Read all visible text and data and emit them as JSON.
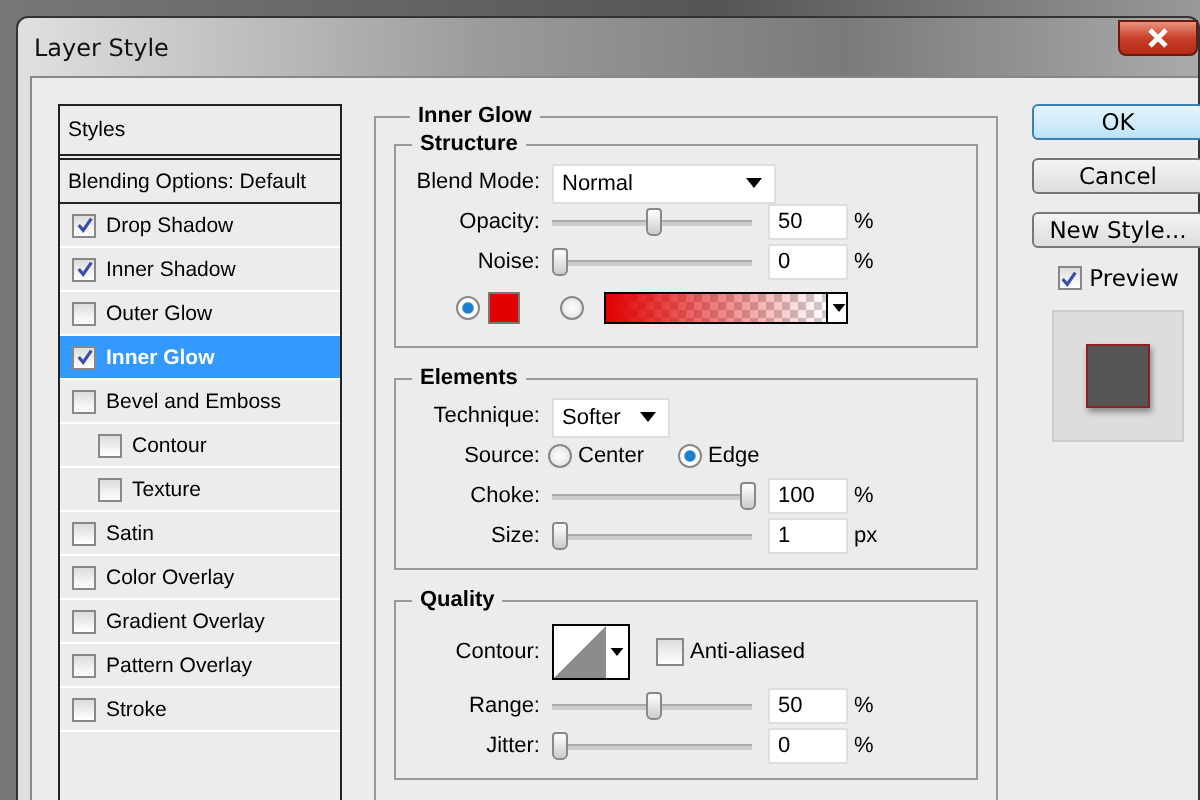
{
  "window": {
    "title": "Layer Style"
  },
  "sidebar": {
    "header": "Styles",
    "items": [
      {
        "label": "Blending Options: Default",
        "kind": "plain",
        "selected": false
      },
      {
        "label": "Drop Shadow",
        "kind": "option",
        "checked": true,
        "selected": false
      },
      {
        "label": "Inner Shadow",
        "kind": "option",
        "checked": true,
        "selected": false
      },
      {
        "label": "Outer Glow",
        "kind": "option",
        "checked": false,
        "selected": false
      },
      {
        "label": "Inner Glow",
        "kind": "option",
        "checked": true,
        "selected": true
      },
      {
        "label": "Bevel and Emboss",
        "kind": "option",
        "checked": false,
        "selected": false,
        "children": [
          {
            "label": "Contour",
            "checked": false,
            "selected": false
          },
          {
            "label": "Texture",
            "checked": false,
            "selected": false
          }
        ]
      },
      {
        "label": "Satin",
        "kind": "option",
        "checked": false,
        "selected": false
      },
      {
        "label": "Color Overlay",
        "kind": "option",
        "checked": false,
        "selected": false
      },
      {
        "label": "Gradient Overlay",
        "kind": "option",
        "checked": false,
        "selected": false
      },
      {
        "label": "Pattern Overlay",
        "kind": "option",
        "checked": false,
        "selected": false
      },
      {
        "label": "Stroke",
        "kind": "option",
        "checked": false,
        "selected": false
      }
    ]
  },
  "panel": {
    "title": "Inner Glow",
    "structure": {
      "title": "Structure",
      "blend_mode": {
        "label": "Blend Mode:",
        "value": "Normal"
      },
      "sliders": [
        {
          "label": "Opacity:",
          "value": "50",
          "unit": "%",
          "level": 0.5
        },
        {
          "label": "Noise:",
          "value": "0",
          "unit": "%",
          "level": 0
        }
      ],
      "fill": [
        {
          "kind": "swatch",
          "selected": true,
          "color": "#e00000"
        },
        {
          "kind": "gradient",
          "selected": false
        }
      ]
    },
    "elements": {
      "title": "Elements",
      "technique": {
        "label": "Technique:",
        "value": "Softer"
      },
      "source": {
        "label": "Source:",
        "options": [
          {
            "label": "Center",
            "selected": false
          },
          {
            "label": "Edge",
            "selected": true
          }
        ]
      },
      "sliders": [
        {
          "label": "Choke:",
          "value": "100",
          "unit": "%",
          "level": 1
        },
        {
          "label": "Size:",
          "value": "1",
          "unit": "px",
          "level": 0
        }
      ]
    },
    "quality": {
      "title": "Quality",
      "contour": {
        "label": "Contour:"
      },
      "anti_aliased": {
        "label": "Anti-aliased",
        "checked": false
      },
      "sliders": [
        {
          "label": "Range:",
          "value": "50",
          "unit": "%",
          "level": 0.5
        },
        {
          "label": "Jitter:",
          "value": "0",
          "unit": "%",
          "level": 0
        }
      ]
    }
  },
  "buttons": [
    {
      "label": "OK",
      "default": true
    },
    {
      "label": "Cancel",
      "default": false
    },
    {
      "label": "New Style...",
      "default": false
    }
  ],
  "preview": {
    "label": "Preview",
    "checked": true
  }
}
